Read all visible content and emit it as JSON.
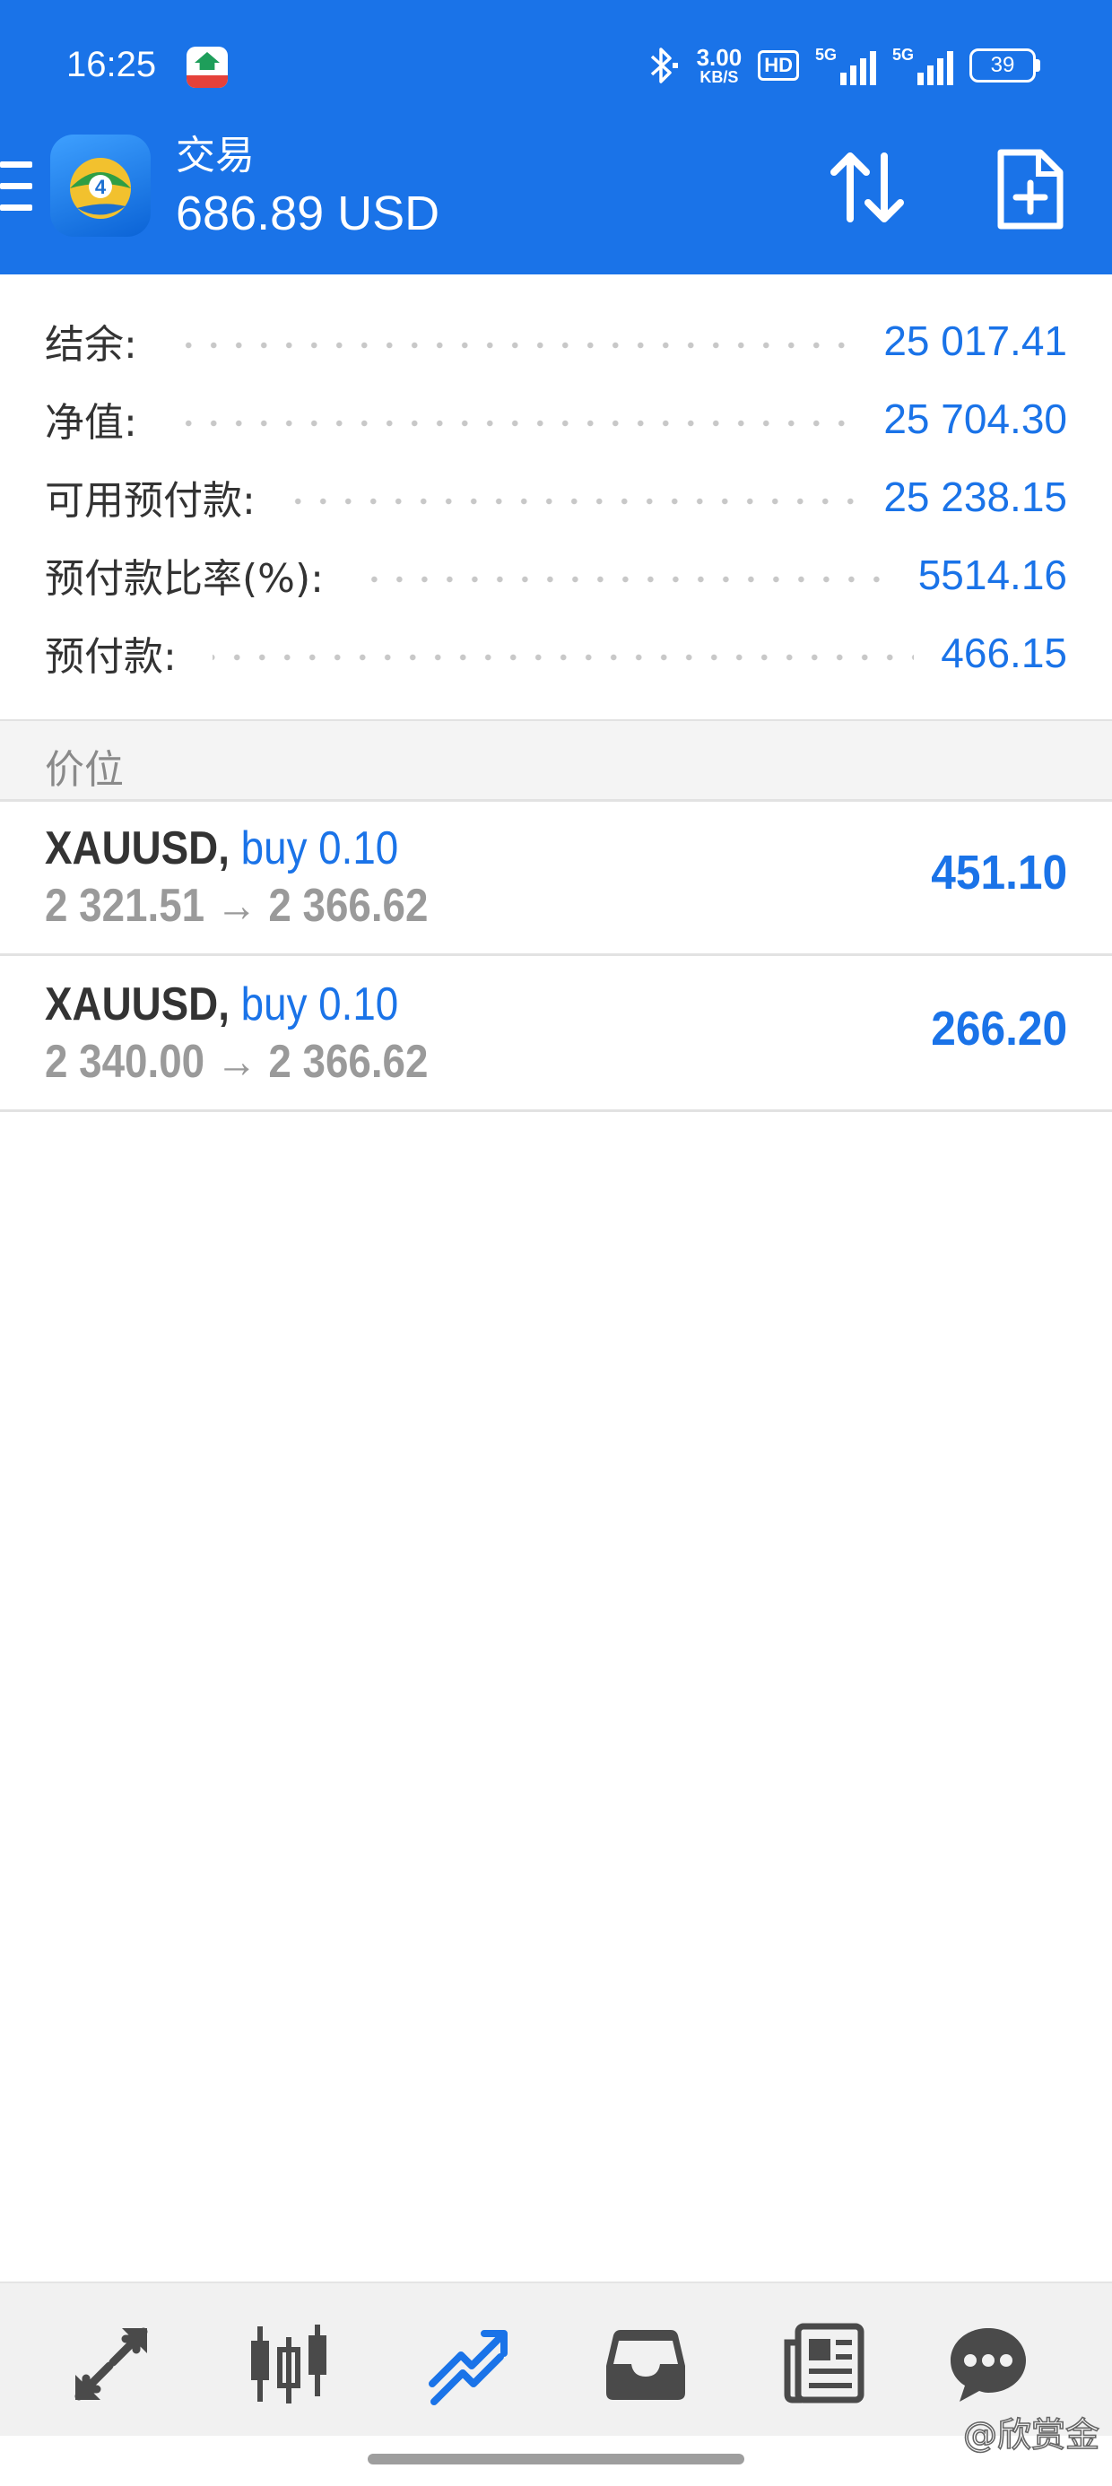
{
  "status_bar": {
    "time": "16:25",
    "net_speed_value": "3.00",
    "net_speed_unit": "KB/S",
    "hd_label": "HD",
    "signal1_label": "5G",
    "signal2_label": "5G",
    "battery_level": "39"
  },
  "app_bar": {
    "title": "交易",
    "balance": "686.89 USD"
  },
  "summary": {
    "rows": [
      {
        "label": "结余:",
        "value": "25 017.41"
      },
      {
        "label": "净值:",
        "value": "25 704.30"
      },
      {
        "label": "可用预付款:",
        "value": "25 238.15"
      },
      {
        "label": "预付款比率(%):",
        "value": "5514.16"
      },
      {
        "label": "预付款:",
        "value": "466.15"
      }
    ]
  },
  "positions_header": "价位",
  "positions": [
    {
      "symbol": "XAUUSD,",
      "side": "buy 0.10",
      "open_price": "2 321.51",
      "arrow": "→",
      "current_price": "2 366.62",
      "profit": "451.10"
    },
    {
      "symbol": "XAUUSD,",
      "side": "buy 0.10",
      "open_price": "2 340.00",
      "arrow": "→",
      "current_price": "2 366.62",
      "profit": "266.20"
    }
  ],
  "bottom_nav": {
    "items": [
      {
        "icon": "quotes-icon",
        "active": false
      },
      {
        "icon": "chart-icon",
        "active": false
      },
      {
        "icon": "trade-icon",
        "active": true
      },
      {
        "icon": "history-icon",
        "active": false
      },
      {
        "icon": "news-icon",
        "active": false
      },
      {
        "icon": "chat-icon",
        "active": false
      }
    ]
  },
  "watermark": "@欣赏金",
  "colors": {
    "accent": "#1a73e8",
    "nav_icon": "#4a4a4a",
    "muted_text": "#9a9a9a"
  }
}
